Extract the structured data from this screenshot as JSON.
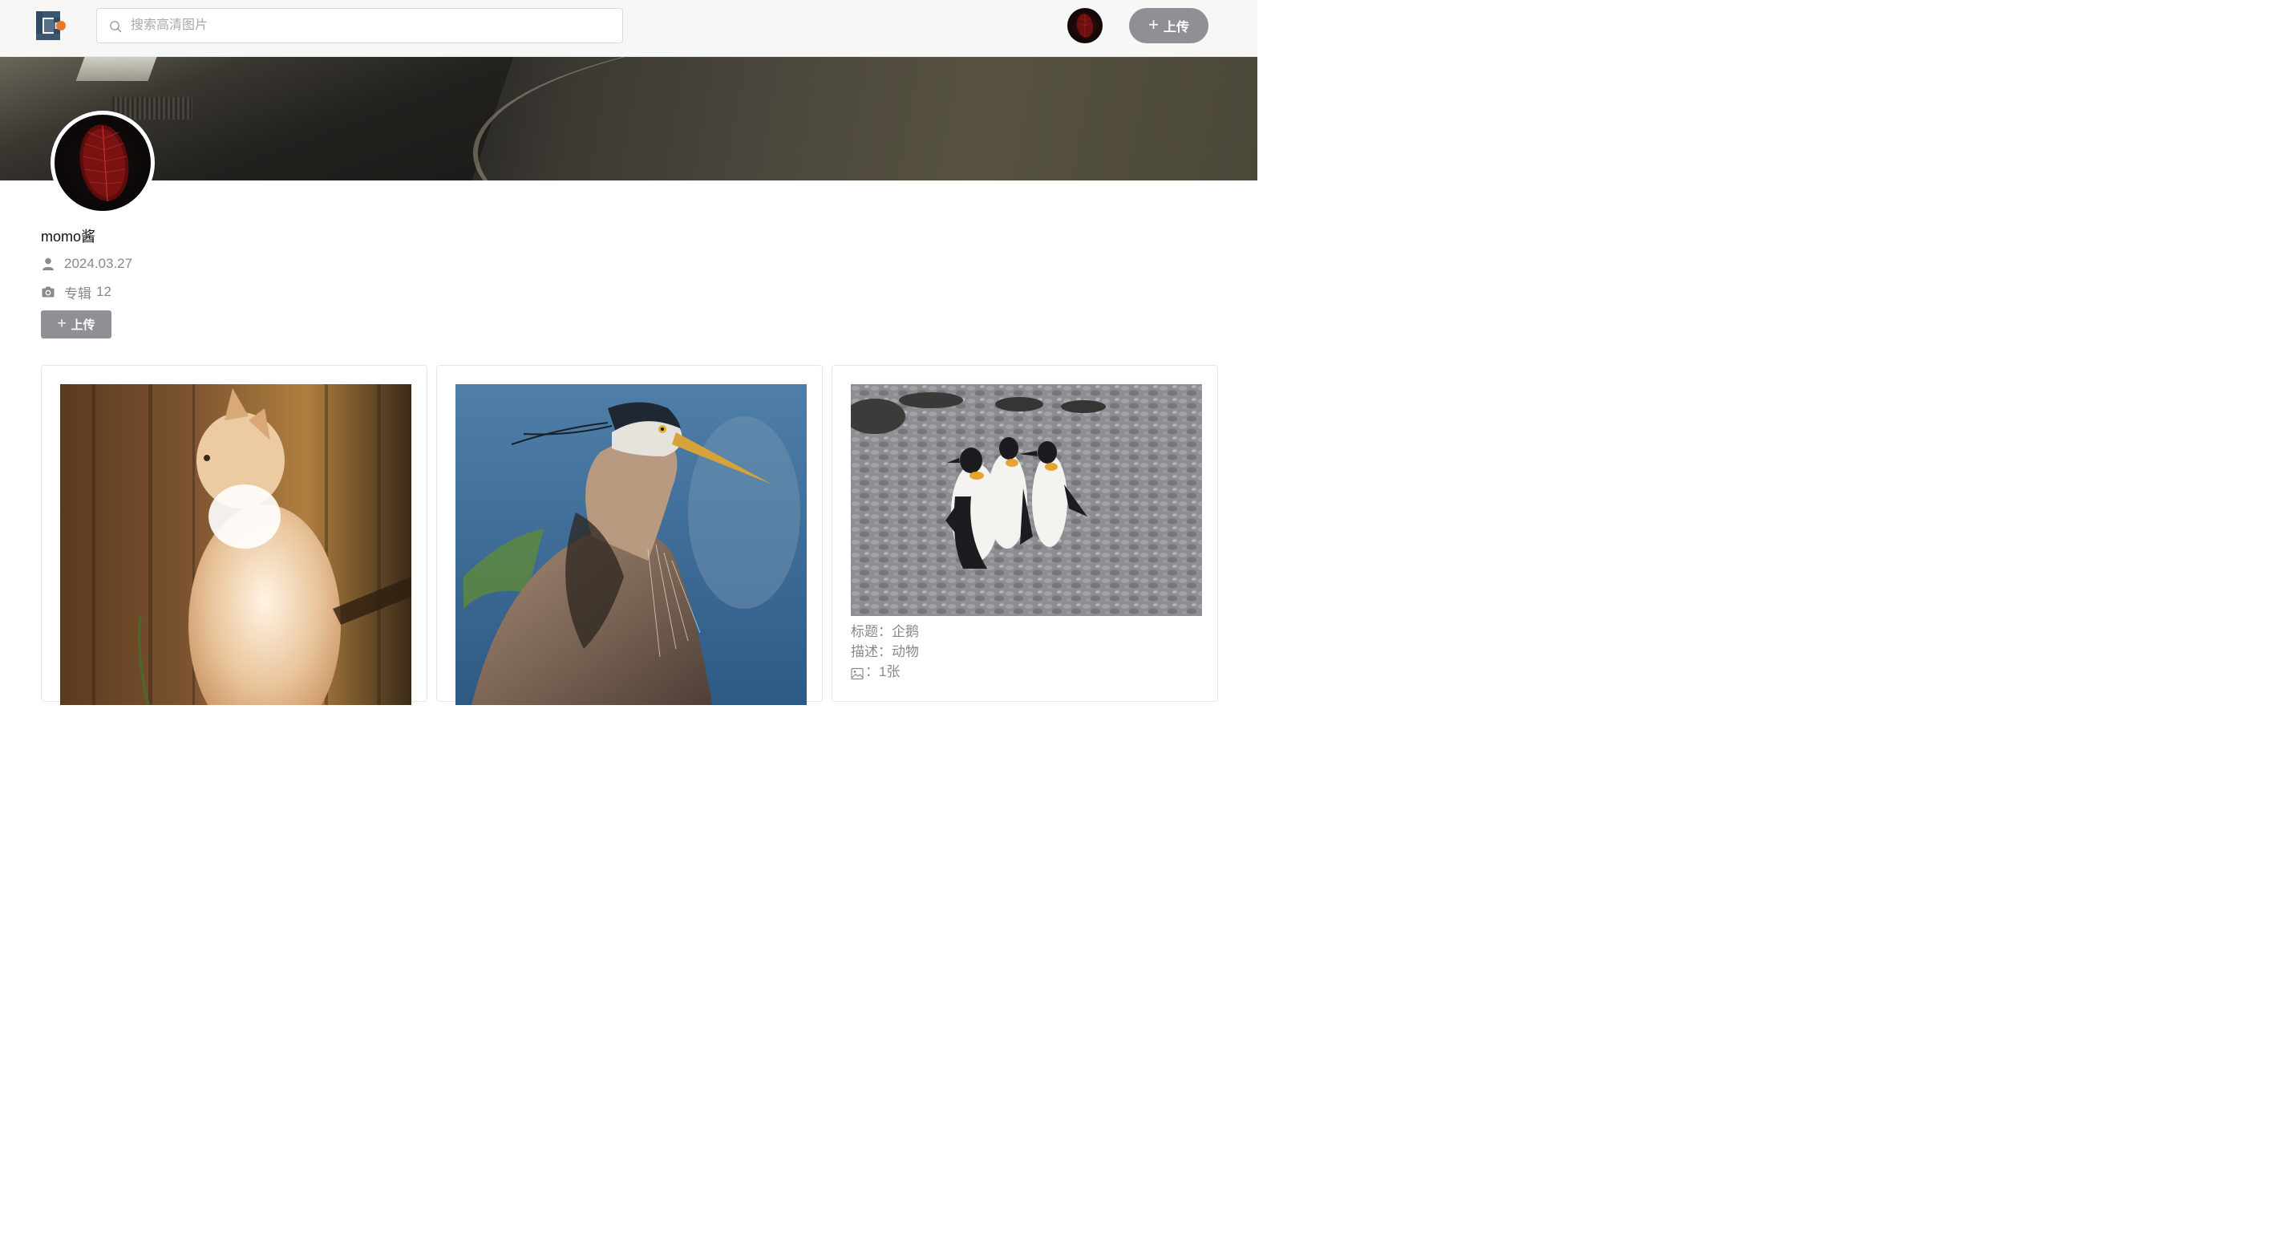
{
  "header": {
    "search_placeholder": "搜索高清图片",
    "upload_label": "上传"
  },
  "profile": {
    "username": "momo酱",
    "join_date": "2024.03.27",
    "album_label": "专辑",
    "album_count": "12",
    "upload_label": "上传"
  },
  "albums": [
    {
      "photo": "cat"
    },
    {
      "photo": "heron"
    },
    {
      "photo": "penguins",
      "title_label": "标题：",
      "title": "企鹅",
      "desc_label": "描述：",
      "desc": "动物",
      "count_sep": "：",
      "count": "1张"
    }
  ],
  "colors": {
    "accent_button": "#8f9096",
    "topbar_bg": "#f7f7f6",
    "meta_text": "#888888",
    "logo_dark": "#2f4a63",
    "logo_orange": "#e87b2c"
  },
  "icons": {
    "logo": "logo-icon",
    "search": "search-icon",
    "plus": "plus-icon",
    "user": "user-icon",
    "camera": "camera-icon",
    "image": "image-icon"
  }
}
